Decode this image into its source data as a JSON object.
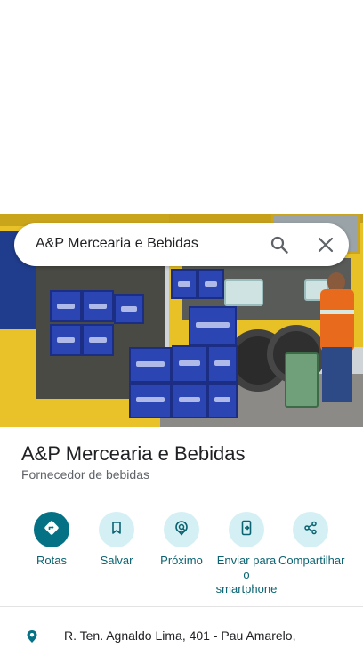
{
  "search": {
    "query": "A&P Mercearia e Bebidas"
  },
  "place": {
    "title": "A&P Mercearia e Bebidas",
    "category": "Fornecedor de bebidas"
  },
  "actions": [
    {
      "label": "Rotas",
      "icon": "directions-icon"
    },
    {
      "label": "Salvar",
      "icon": "bookmark-icon"
    },
    {
      "label": "Próximo",
      "icon": "nearby-icon"
    },
    {
      "label": "Enviar para o smartphone",
      "icon": "send-to-phone-icon"
    },
    {
      "label": "Compartilhar",
      "icon": "share-icon"
    }
  ],
  "address": {
    "text": "R. Ten. Agnaldo Lima, 401 - Pau Amarelo,"
  },
  "colors": {
    "primary_action": "#047185",
    "action_bg": "#d4f0f5",
    "action_text": "#0b6371"
  }
}
